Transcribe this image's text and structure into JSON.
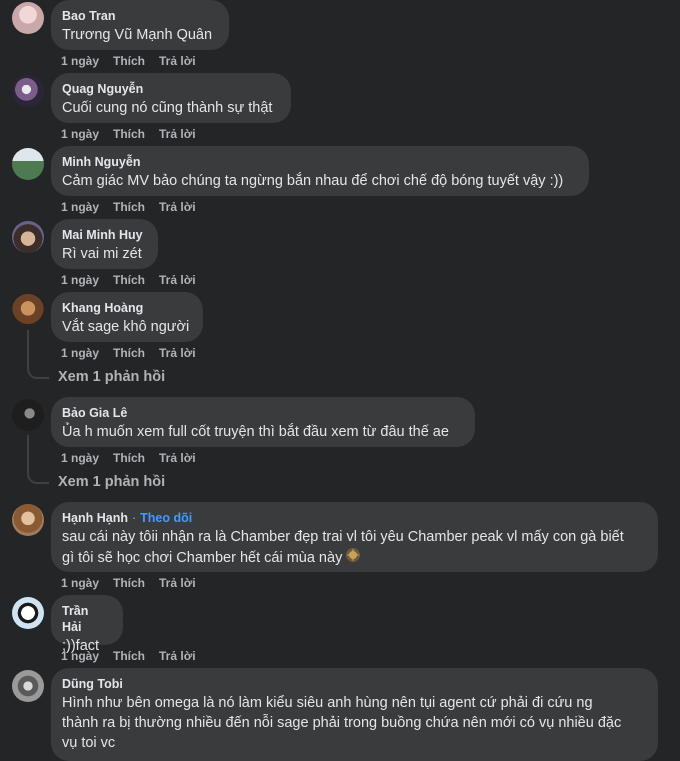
{
  "comments": [
    {
      "name": "Bao Tran",
      "text": "Trương Vũ Mạnh Quân",
      "time": "1 ngày",
      "like": "Thích",
      "reply": "Trả lời"
    },
    {
      "name": "Quag Nguyễn",
      "text": "Cuối cung nó cũng thành sự thật",
      "time": "1 ngày",
      "like": "Thích",
      "reply": "Trả lời"
    },
    {
      "name": "Minh Nguyễn",
      "text": "Cảm giác MV bảo chúng ta ngừng bắn nhau để chơi chế độ bóng tuyết vậy :))",
      "time": "1 ngày",
      "like": "Thích",
      "reply": "Trả lời"
    },
    {
      "name": "Mai Minh Huy",
      "text": "Rì vai mi zét",
      "time": "1 ngày",
      "like": "Thích",
      "reply": "Trả lời"
    },
    {
      "name": "Khang Hoàng",
      "text": "Vắt sage khô người",
      "time": "1 ngày",
      "like": "Thích",
      "reply": "Trả lời",
      "view_replies": "Xem 1 phản hồi"
    },
    {
      "name": "Bảo Gia Lê",
      "text": "Ủa h muốn xem full cốt truyện thì bắt đầu xem từ đâu thế ae",
      "time": "1 ngày",
      "like": "Thích",
      "reply": "Trả lời",
      "view_replies": "Xem 1 phản hồi"
    },
    {
      "name": "Hạnh Hạnh",
      "follow_sep": "·",
      "follow": "Theo dõi",
      "text_line1": "sau cái này tôii nhận ra là Chamber đẹp trai vl tôi yêu Chamber peak vl mấy con gà biết",
      "text_line2": "gì tôi sẽ học chơi Chamber hết cái mùa này",
      "time": "1 ngày",
      "like": "Thích",
      "reply": "Trả lời"
    },
    {
      "name": "Trần Hải",
      "text": ";))fact",
      "time": "1 ngày",
      "like": "Thích",
      "reply": "Trả lời"
    },
    {
      "name": "Dũng Tobi",
      "text_line1": "Hình như bên omega là nó làm kiểu siêu anh hùng nên tụi agent cứ phải đi cứu ng",
      "text_line2": "thành ra bị thường nhiều đến nỗi sage phải trong buồng chứa nên mới có vụ nhiều đặc",
      "text_line3": "vụ toi vc"
    }
  ]
}
